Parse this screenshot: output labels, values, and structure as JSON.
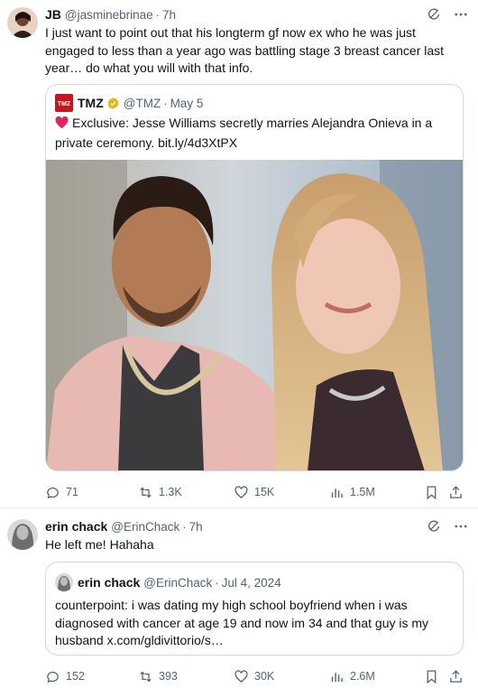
{
  "tweets": [
    {
      "author_name": "JB",
      "handle": "@jasminebrinae",
      "dot": "·",
      "time": "7h",
      "text": "I just want to point out that his longterm gf now ex who he was just engaged to less than a year ago was battling stage 3 breast cancer last year… do what you will with that info.",
      "quote": {
        "author_name": "TMZ",
        "handle": "@TMZ",
        "dot": "·",
        "date": "May 5",
        "logo_text": "TMZ",
        "text": "Exclusive: Jesse Williams secretly marries Alejandra Onieva in a private ceremony. bit.ly/4d3XtPX"
      },
      "stats": {
        "replies": "71",
        "reposts": "1.3K",
        "likes": "15K",
        "views": "1.5M"
      }
    },
    {
      "author_name": "erin chack",
      "handle": "@ErinChack",
      "dot": "·",
      "time": "7h",
      "text": "He left me! Hahaha",
      "quote": {
        "author_name": "erin chack",
        "handle": "@ErinChack",
        "dot": "·",
        "date": "Jul 4, 2024",
        "text": "counterpoint: i was dating my high school boyfriend when i was diagnosed with cancer at age 19 and now im 34 and that guy is my husband x.com/gldivittorio/s…"
      },
      "stats": {
        "replies": "152",
        "reposts": "393",
        "likes": "30K",
        "views": "2.6M"
      }
    }
  ],
  "colors": {
    "text": "#0f1419",
    "secondary": "#536471",
    "border": "#cfd9de",
    "verified_gold": "#e2b719",
    "tmz_red": "#c4161c",
    "heart": "#e0245e"
  },
  "icons": [
    "grok-icon",
    "more-icon",
    "reply-icon",
    "repost-icon",
    "like-icon",
    "views-icon",
    "bookmark-icon",
    "share-icon",
    "verified-badge-icon",
    "heart-emoji"
  ]
}
